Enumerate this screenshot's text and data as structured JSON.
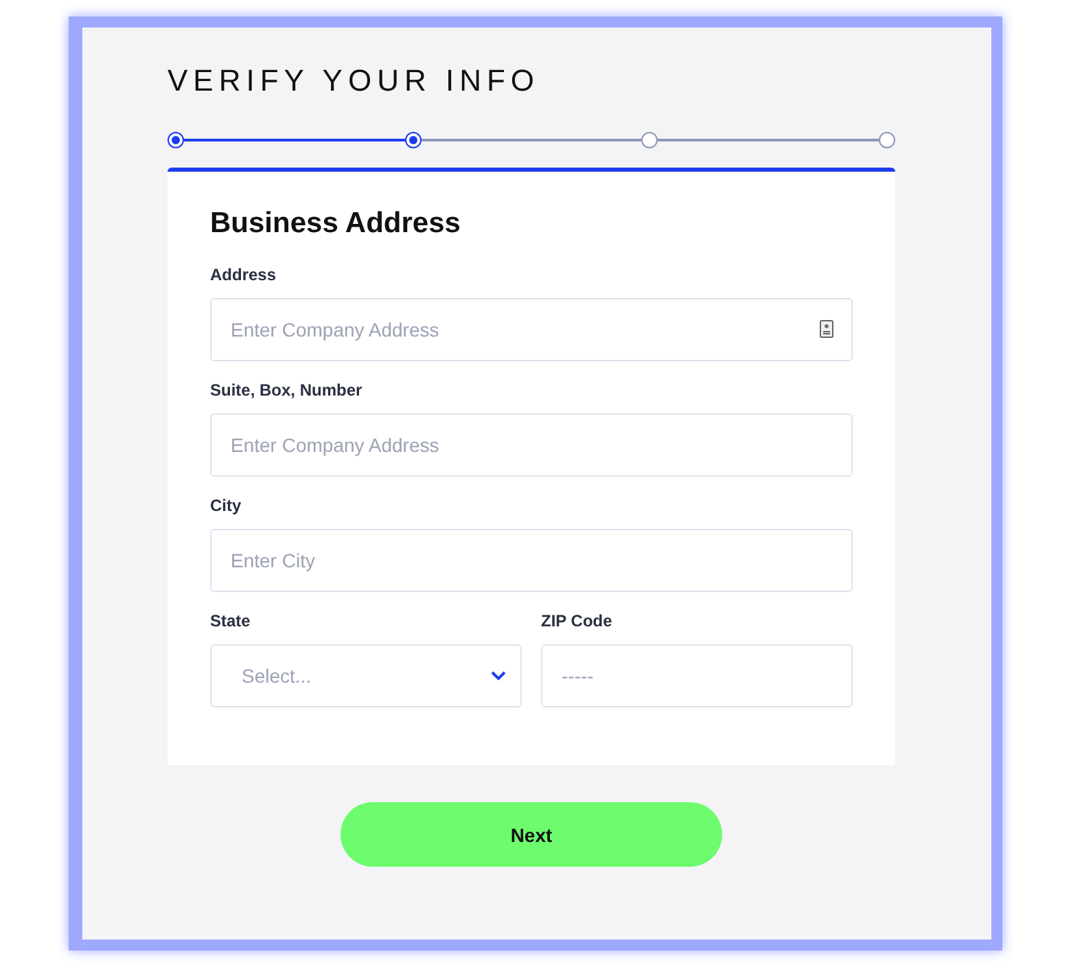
{
  "title": "VERIFY YOUR INFO",
  "steps": [
    {
      "done": true
    },
    {
      "done": true
    },
    {
      "done": false
    },
    {
      "done": false
    }
  ],
  "card": {
    "heading": "Business Address",
    "rows": [
      {
        "fields": [
          {
            "kind": "text",
            "label": "Address",
            "placeholder": "Enter Company Address",
            "autofill_icon": true
          }
        ]
      },
      {
        "fields": [
          {
            "kind": "text",
            "label": "Suite, Box, Number",
            "placeholder": "Enter Company Address",
            "autofill_icon": false
          }
        ]
      },
      {
        "fields": [
          {
            "kind": "text",
            "label": "City",
            "placeholder": "Enter City",
            "autofill_icon": false
          }
        ]
      },
      {
        "fields": [
          {
            "kind": "select",
            "label": "State",
            "placeholder": "Select..."
          },
          {
            "kind": "text",
            "label": "ZIP Code",
            "placeholder": "-----",
            "autofill_icon": false
          }
        ]
      }
    ]
  },
  "button": "Next"
}
